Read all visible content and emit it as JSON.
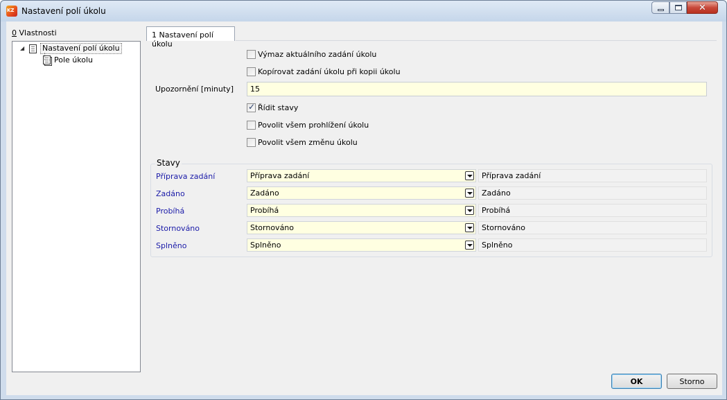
{
  "window": {
    "title": "Nastavení polí úkolu",
    "close_glyph": "✕"
  },
  "sidebar": {
    "label_accel": "0",
    "label_rest": " Vlastnosti",
    "tree": [
      {
        "label": "Nastavení polí úkolu",
        "icon": "document-icon",
        "selected": true
      },
      {
        "label": "Pole úkolu",
        "icon": "documents-icon",
        "selected": false
      }
    ]
  },
  "tabs": [
    {
      "label": "1 Nastavení polí úkolu"
    }
  ],
  "form": {
    "vymaz": {
      "label": "Výmaz aktuálního zadání úkolu",
      "checked": false
    },
    "kopirovat": {
      "label": "Kopírovat zadání úkolu při kopii úkolu",
      "checked": false
    },
    "upozorneni": {
      "label": "Upozornění [minuty]",
      "value": "15"
    },
    "ridit": {
      "label": "Řídit stavy",
      "checked": true
    },
    "prohlizeni": {
      "label": "Povolit všem prohlížení úkolu",
      "checked": false
    },
    "zmena": {
      "label": "Povolit všem změnu úkolu",
      "checked": false
    }
  },
  "stavy": {
    "title": "Stavy",
    "rows": [
      {
        "label": "Příprava zadání",
        "select": "Příprava zadání",
        "readonly": "Příprava zadání"
      },
      {
        "label": "Zadáno",
        "select": "Zadáno",
        "readonly": "Zadáno"
      },
      {
        "label": "Probíhá",
        "select": "Probíhá",
        "readonly": "Probíhá"
      },
      {
        "label": "Stornováno",
        "select": "Stornováno",
        "readonly": "Stornováno"
      },
      {
        "label": "Splněno",
        "select": "Splněno",
        "readonly": "Splněno"
      }
    ]
  },
  "buttons": {
    "ok": "OK",
    "cancel": "Storno"
  },
  "colors": {
    "stav_label": "#1a1aa8",
    "input_bg": "#ffffe1",
    "client_bg": "#f0f0f0"
  }
}
